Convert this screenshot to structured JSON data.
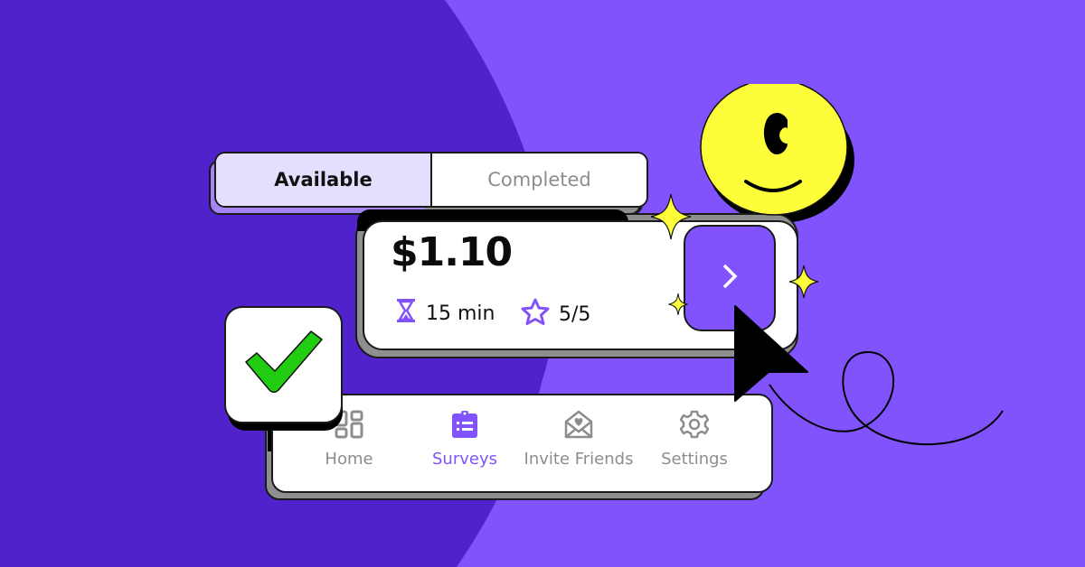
{
  "colors": {
    "background_light": "#8153fc",
    "background_dark": "#5022cc",
    "accent": "#8153fc",
    "tab_active_bg": "#e5defd",
    "smiley_yellow": "#fdfd3a",
    "check_green": "#22cc11",
    "muted_text": "#8d8d8d"
  },
  "tabs": [
    {
      "label": "Available",
      "active": true
    },
    {
      "label": "Completed",
      "active": false
    }
  ],
  "survey_card": {
    "price": "$1.10",
    "duration_icon": "hourglass-icon",
    "duration": "15 min",
    "rating_icon": "star-icon",
    "rating": "5/5",
    "go_button_icon": "chevron-right-icon"
  },
  "decorations": {
    "smiley": "smiley-face-icon",
    "check": "checkmark-icon",
    "cursor": "mouse-pointer-icon",
    "sparkles": "sparkle-icon",
    "squiggle": "loop-line"
  },
  "bottom_nav": [
    {
      "label": "Home",
      "icon": "grid-icon",
      "active": false
    },
    {
      "label": "Surveys",
      "icon": "clipboard-list-icon",
      "active": true
    },
    {
      "label": "Invite Friends",
      "icon": "envelope-heart-icon",
      "active": false
    },
    {
      "label": "Settings",
      "icon": "gear-icon",
      "active": false
    }
  ]
}
